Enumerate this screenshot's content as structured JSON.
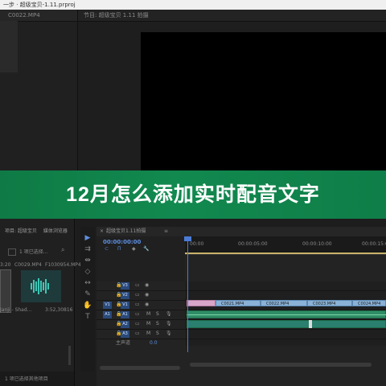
{
  "window": {
    "title": "一步 · 超级宝贝-1.11.prproj"
  },
  "source_panel": {
    "clip_name": "C0022.MP4"
  },
  "program_monitor": {
    "title": "节目: 超级宝贝 1.11 拍摄"
  },
  "banner": {
    "title": "12月怎么添加实时配音文字",
    "color": "#11894f"
  },
  "project_panel": {
    "title": "项目: 超级宝贝",
    "tab2": "媒体浏览器",
    "selection": "1 项已选择...",
    "items": [
      {
        "name": "C0029.MP4",
        "duration": "3:20"
      },
      {
        "name": "F1030954.MP4",
        "duration": ""
      },
      {
        "name": "Janji - Shad...",
        "duration": "3:52,30816"
      }
    ],
    "footer": "1 项已选择其他项目"
  },
  "timeline": {
    "tab_title": "超级宝贝1.11拍摄",
    "timecode": "00:00:00:00",
    "ruler_labels": [
      "00:00",
      "00:00:05:00",
      "00:00:10:00",
      "00:00:15:00"
    ],
    "tracks": [
      {
        "id": "V3",
        "kind": "video"
      },
      {
        "id": "V2",
        "kind": "video"
      },
      {
        "id": "V1",
        "kind": "video",
        "source": "V1"
      },
      {
        "id": "A1",
        "kind": "audio",
        "source": "A1",
        "m": "M",
        "s": "S"
      },
      {
        "id": "A2",
        "kind": "audio",
        "m": "M",
        "s": "S"
      },
      {
        "id": "A3",
        "kind": "audio",
        "m": "M",
        "s": "S"
      }
    ],
    "master": {
      "label": "主声道",
      "value": "0.0"
    },
    "clips": [
      "C0021.MP4",
      "C0022.MP4",
      "C0023.MP4",
      "C0024.MP4"
    ]
  },
  "tools": [
    "selection-tool",
    "track-select-tool",
    "ripple-edit-tool",
    "razor-tool",
    "slip-tool",
    "pen-tool",
    "hand-tool",
    "type-tool"
  ]
}
